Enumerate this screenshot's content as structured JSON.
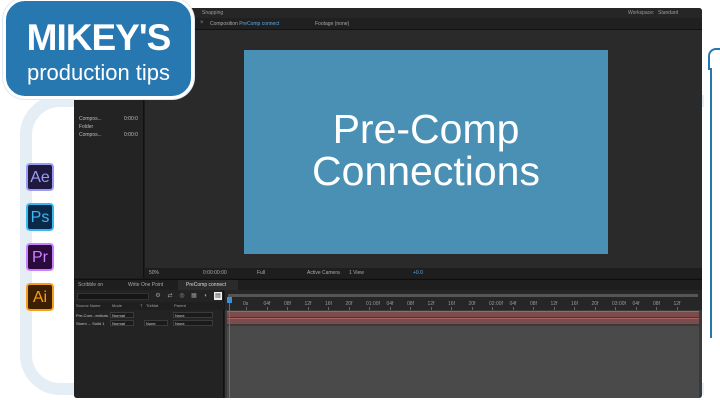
{
  "logo": {
    "title": "MIKEY'S",
    "subtitle": "production tips"
  },
  "apps": {
    "ae": "Ae",
    "ps": "Ps",
    "pr": "Pr",
    "ai": "Ai"
  },
  "ae_window": {
    "top_bar": {
      "snapping": "Snapping",
      "workspace_label": "Workspace:",
      "workspace_value": "Standard"
    },
    "tabs": {
      "composition_label": "Composition",
      "composition_name": "PreComp connect",
      "footage": "Footage (none)"
    },
    "project_items": [
      {
        "name": "Compos...",
        "value": "0:00:0"
      },
      {
        "name": "Folder",
        "value": ""
      },
      {
        "name": "Compos...",
        "value": "0:00:0"
      }
    ],
    "viewer": {
      "title_line1": "Pre-Comp",
      "title_line2": "Connections",
      "zoom": "50%",
      "timecode": "0:00:00:00",
      "resolution": "Full",
      "camera": "Active Camera",
      "views": "1 View",
      "exposure": "+0.0"
    },
    "timeline_tabs": [
      "Scribble on",
      "Write One Point",
      "PreComp connect"
    ],
    "timeline_columns": {
      "source": "Source Name",
      "mode": "Mode",
      "t": "T",
      "trkmat": "TrkMat",
      "parent": "Parent"
    },
    "layers": [
      {
        "name": "Pre-Com...ections",
        "mode": "Normal",
        "trkmat": "",
        "parent": "None"
      },
      {
        "name": "Storm ... Solid 1",
        "mode": "Normal",
        "trkmat": "None",
        "parent": "None"
      }
    ],
    "ruler_ticks": [
      "0s",
      "04f",
      "08f",
      "12f",
      "16f",
      "20f",
      "01:00f",
      "04f",
      "08f",
      "12f",
      "16f",
      "20f",
      "02:00f",
      "04f",
      "08f",
      "12f",
      "16f",
      "20f",
      "03:00f",
      "04f",
      "08f",
      "12f"
    ]
  }
}
